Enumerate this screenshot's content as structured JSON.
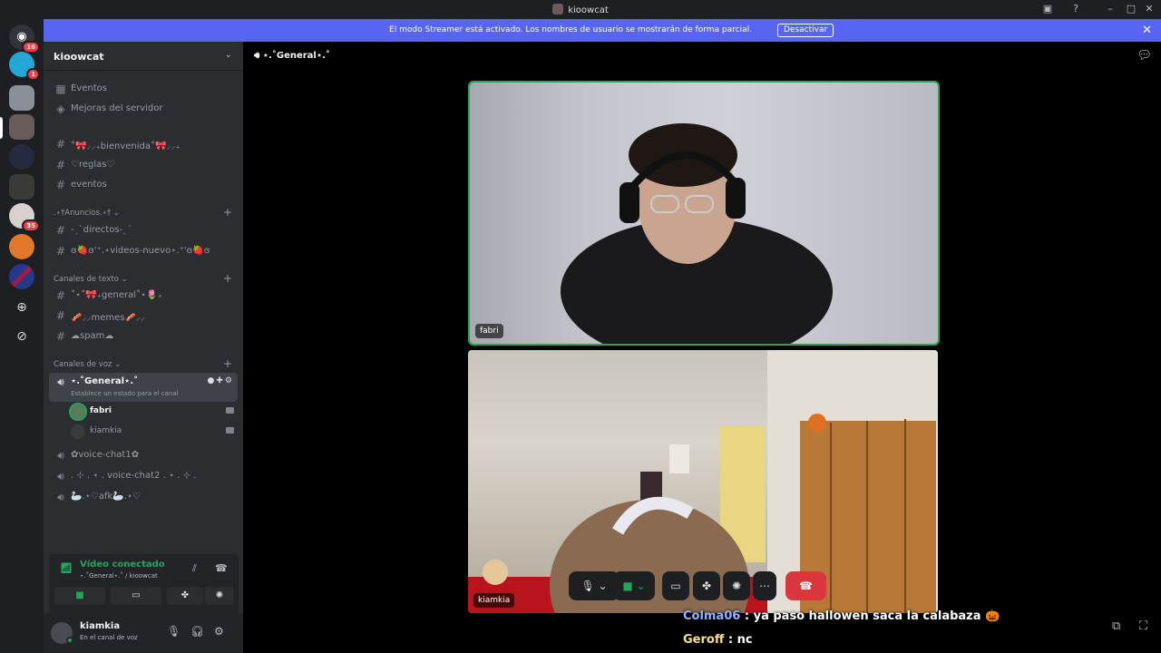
{
  "titlebar": {
    "title": "kioowcat"
  },
  "banner": {
    "text": "El modo Streamer está activado. Los nombres de usuario se mostrarán de forma parcial.",
    "button": "Desactivar"
  },
  "servers": {
    "badges": [
      "16",
      "1",
      "35"
    ]
  },
  "sidebar": {
    "guild_name": "kioowcat",
    "items": [
      {
        "label": "Eventos"
      },
      {
        "label": "Mejoras del servidor"
      }
    ],
    "channels_top": [
      {
        "label": "˚🎀⸝⸝₊bienvenida˚🎀⸝⸝₊"
      },
      {
        "label": "♡reglas♡"
      },
      {
        "label": "eventos"
      }
    ],
    "category_announcements": ".⋆†Anuncios.⋆†",
    "channels_announcements": [
      {
        "label": "-ˏˋdirectos-ˎˊ"
      },
      {
        "label": "ɞ🍓ɞ'⁺.⋆videos-nuevo⋆.⁺'ɞ🍓ɞ"
      }
    ],
    "category_text": "Canales de texto",
    "channels_text": [
      {
        "label": "˚⋆˚🎀₊general˚⋆🌷₊"
      },
      {
        "label": "🥓⸝⸝memes🥓⸝⸝"
      },
      {
        "label": "☁spam☁"
      }
    ],
    "category_voice": "Canales de voz",
    "voice_active": {
      "label": "⋆.˚General⋆.˚",
      "status": "Establece un estado para el canal"
    },
    "voice_members": [
      {
        "name": "fabri"
      },
      {
        "name": "kiamkia"
      }
    ],
    "channels_voice": [
      {
        "label": "✿voice-chat1✿"
      },
      {
        "label": ". ⊹ . ⋆ . voice-chat2 . ⋆ . ⊹ ."
      },
      {
        "label": "🦢.⋆♡afk🦢.⋆♡"
      }
    ]
  },
  "voice_panel": {
    "status": "Vídeo conectado",
    "location": "⋆.˚General⋆.˚ / kioowcat"
  },
  "user_panel": {
    "username": "kiamkia",
    "status": "En el canal de voz"
  },
  "stage": {
    "channel": "⋆.˚General⋆.˚",
    "tiles": [
      {
        "name": "fabri"
      },
      {
        "name": "kiamkia"
      }
    ]
  },
  "overlay_chat": [
    {
      "nick": "Colma06",
      "message": " : ya paso hallowen saca la calabaza 🎃"
    },
    {
      "nick": "Geroff",
      "message": " : nc"
    }
  ],
  "colors": {
    "accent": "#5865f2",
    "connected": "#23a55a",
    "danger": "#da373c"
  }
}
